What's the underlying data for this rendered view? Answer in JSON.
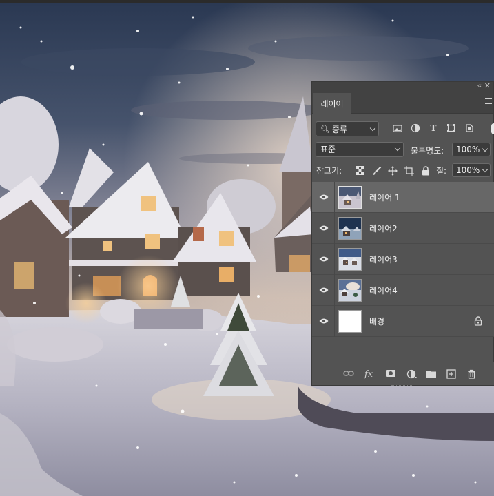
{
  "panel": {
    "tab_label": "레이어",
    "filter": {
      "label": "종류"
    },
    "blend_mode": "표준",
    "opacity": {
      "label": "불투명도:",
      "value": "100%"
    },
    "lock": {
      "label": "잠그기:"
    },
    "fill": {
      "label": "칠:",
      "value": "100%"
    },
    "layers": [
      {
        "name": "레이어 1",
        "selected": true,
        "visible": true,
        "type": "image"
      },
      {
        "name": "레이어2",
        "selected": false,
        "visible": true,
        "type": "image"
      },
      {
        "name": "레이어3",
        "selected": false,
        "visible": true,
        "type": "image"
      },
      {
        "name": "레이어4",
        "selected": false,
        "visible": true,
        "type": "image"
      },
      {
        "name": "배경",
        "selected": false,
        "visible": true,
        "type": "background",
        "locked": true
      }
    ],
    "bottom_icons": [
      "link-icon",
      "fx-icon",
      "mask-icon",
      "adjustment-icon",
      "folder-icon",
      "new-layer-icon",
      "trash-icon"
    ],
    "fx_label": "fx"
  },
  "colors": {
    "panel_bg": "#535353",
    "panel_header": "#424242",
    "selected_layer": "#676767",
    "text": "#e6e6e6"
  }
}
